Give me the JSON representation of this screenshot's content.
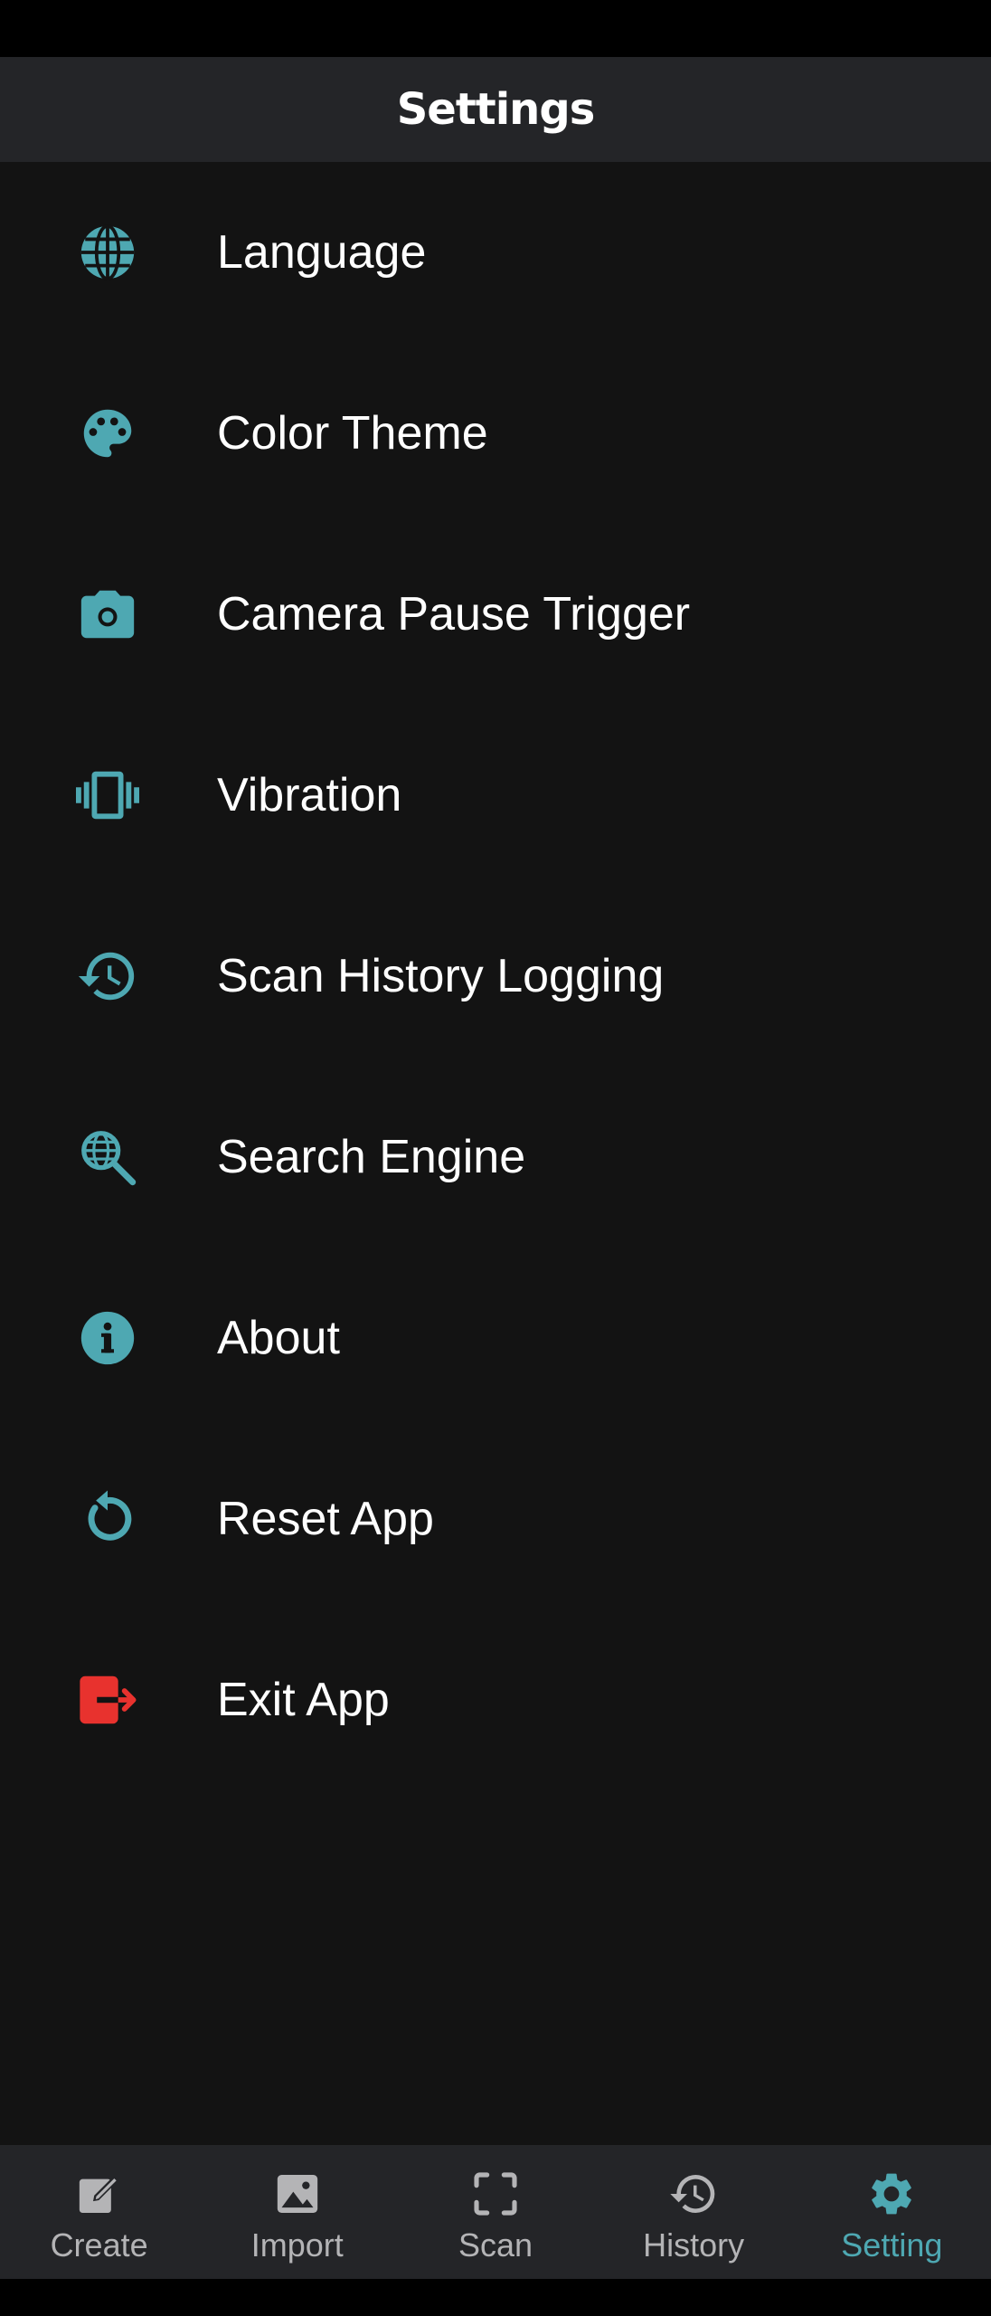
{
  "app_bar": {
    "title": "Settings"
  },
  "colors": {
    "accent": "#4ea8b2",
    "danger": "#e8322e",
    "background": "#131313",
    "bar": "#242528",
    "nav_inactive": "#b4b4b6"
  },
  "settings": {
    "items": [
      {
        "label": "Language",
        "icon": "globe-icon"
      },
      {
        "label": "Color Theme",
        "icon": "palette-icon"
      },
      {
        "label": "Camera Pause Trigger",
        "icon": "camera-icon"
      },
      {
        "label": "Vibration",
        "icon": "vibration-icon"
      },
      {
        "label": "Scan History Logging",
        "icon": "history-icon"
      },
      {
        "label": "Search Engine",
        "icon": "search-globe-icon"
      },
      {
        "label": "About",
        "icon": "info-icon"
      },
      {
        "label": "Reset App",
        "icon": "reset-icon"
      },
      {
        "label": "Exit App",
        "icon": "exit-icon"
      }
    ]
  },
  "bottom_nav": {
    "selected": "Setting",
    "items": [
      {
        "label": "Create",
        "icon": "edit-icon"
      },
      {
        "label": "Import",
        "icon": "image-icon"
      },
      {
        "label": "Scan",
        "icon": "scan-frame-icon"
      },
      {
        "label": "History",
        "icon": "history-icon"
      },
      {
        "label": "Setting",
        "icon": "gear-icon"
      }
    ]
  }
}
